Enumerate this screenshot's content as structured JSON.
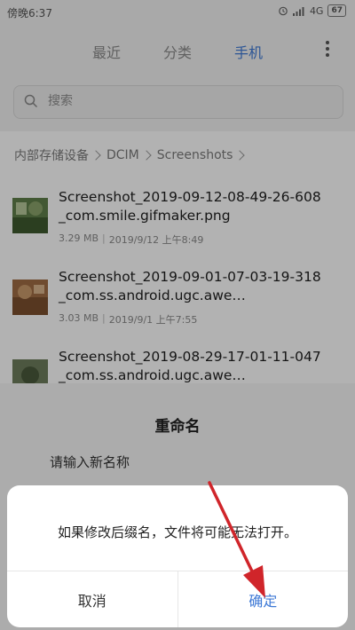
{
  "status_bar": {
    "time": "傍晚6:37",
    "network": "4G",
    "battery": "67"
  },
  "tabs": [
    {
      "label": "最近",
      "active": false
    },
    {
      "label": "分类",
      "active": false
    },
    {
      "label": "手机",
      "active": true
    }
  ],
  "search": {
    "placeholder": "搜索"
  },
  "breadcrumb": [
    "内部存储设备",
    "DCIM",
    "Screenshots"
  ],
  "files": [
    {
      "name": "Screenshot_2019-09-12-08-49-26-608_com.smile.gifmaker.png",
      "size": "3.29 MB",
      "date": "2019/9/12 上午8:49"
    },
    {
      "name": "Screenshot_2019-09-01-07-03-19-318_com.ss.android.ugc.awe…",
      "size": "3.03 MB",
      "date": "2019/9/1 上午7:55"
    },
    {
      "name": "Screenshot_2019-08-29-17-01-11-047_com.ss.android.ugc.awe…",
      "size": "",
      "date": ""
    }
  ],
  "rename_dialog": {
    "title": "重命名",
    "prompt": "请输入新名称"
  },
  "confirm_dialog": {
    "message": "如果修改后缀名，文件将可能无法打开。",
    "cancel_label": "取消",
    "ok_label": "确定"
  },
  "colors": {
    "accent": "#3f7ad6",
    "annotation_arrow": "#d0252a"
  }
}
